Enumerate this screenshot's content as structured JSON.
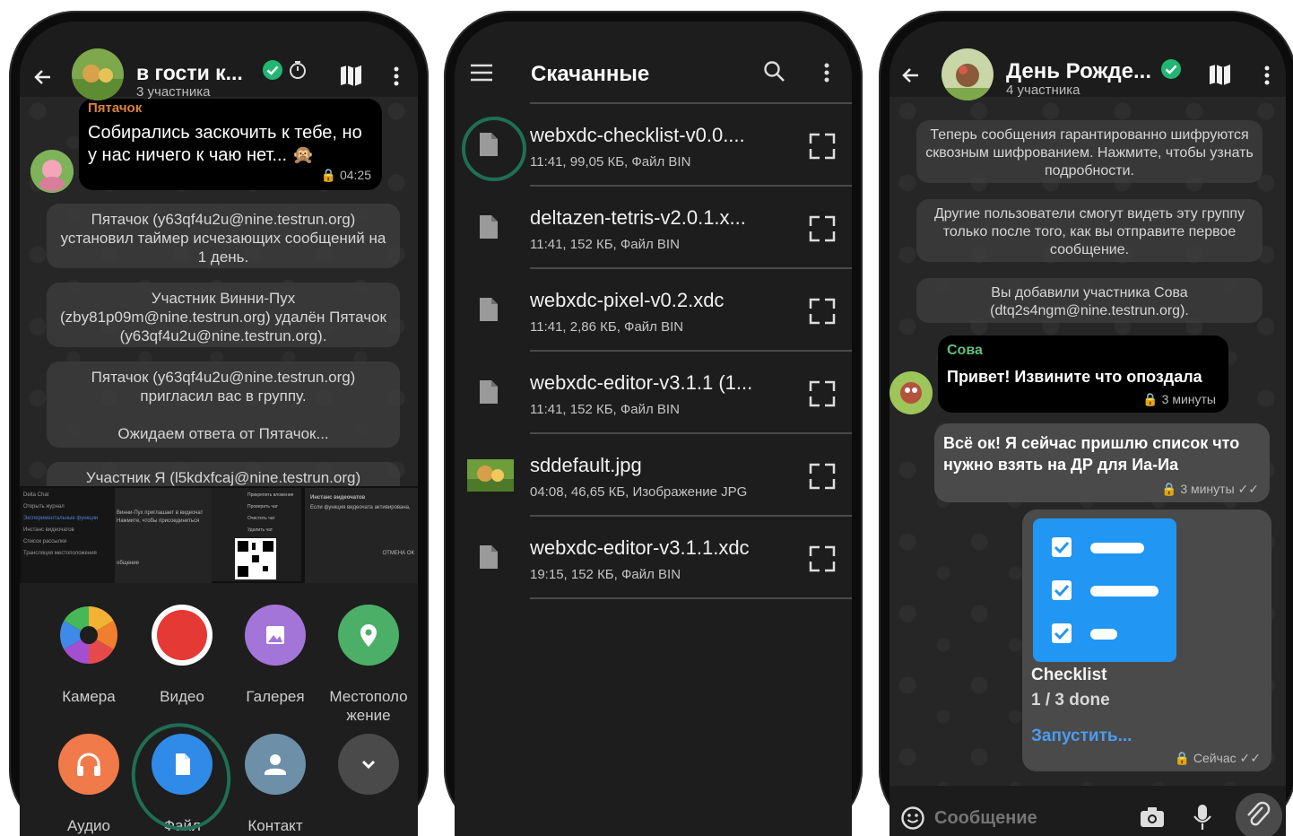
{
  "phone1": {
    "title": "в гости к...",
    "subtitle": "3 участника",
    "partial_sender": "Пятачок",
    "message": {
      "text": "Собирались заскочить к тебе, но у нас ничего к чаю нет... 🙊",
      "time": "04:25"
    },
    "system_messages": [
      "Пятачок (y63qf4u2u@nine.testrun.org) установил таймер исчезающих сообщений на 1 день.",
      "Участник Винни-Пух (zby81p09m@nine.testrun.org) удалён Пятачок (y63qf4u2u@nine.testrun.org).",
      "Пятачок (y63qf4u2u@nine.testrun.org) пригласил вас в группу.\n\nОжидаем ответа от Пятачок...",
      "Участник Я (l5kdxfcaj@nine.testrun.org)"
    ],
    "thumbnails": [
      {
        "lines": [
          "Delta Chat",
          "Открыть журнал",
          "Экспериментальные функции",
          "Инстанс видеочатов",
          "Список рассылки",
          "Трансляция местоположения"
        ]
      },
      {
        "lines": [
          "Винни-Пух приглашает в видеочат",
          "Нажмите, чтобы присоединиться",
          "общение"
        ]
      },
      {
        "lines": [
          "Прикрепить вложение",
          "Проверить чат",
          "Очистить чат",
          "Удалить чат"
        ]
      },
      {
        "lines": [
          "Инстанс видеочатов",
          "Если функция видеочата активирована,",
          "ОТМЕНА",
          "ОК"
        ]
      }
    ],
    "attachments": [
      {
        "label": "Камера",
        "color": "#2b2b2b",
        "icon": "camera-icon"
      },
      {
        "label": "Видео",
        "color": "#ffffff",
        "icon": "record-icon"
      },
      {
        "label": "Галерея",
        "color": "#a475d8",
        "icon": "gallery-icon"
      },
      {
        "label": "Местоположение",
        "color": "#4caf68",
        "icon": "location-icon"
      },
      {
        "label": "Аудио",
        "color": "#f07a4a",
        "icon": "headphones-icon"
      },
      {
        "label": "Файл",
        "color": "#2f8ae8",
        "icon": "file-icon"
      },
      {
        "label": "Контакт",
        "color": "#6d8fa8",
        "icon": "contact-icon"
      },
      {
        "label": "",
        "color": "#4a4a4a",
        "icon": "chevron-down-icon"
      }
    ]
  },
  "phone2": {
    "title": "Скачанные",
    "files": [
      {
        "name": "webxdc-checklist-v0.0....",
        "meta": "11:41, 99,05 КБ, Файл BIN",
        "thumb": false
      },
      {
        "name": "deltazen-tetris-v2.0.1.x...",
        "meta": "11:41, 152 КБ, Файл BIN",
        "thumb": false
      },
      {
        "name": "webxdc-pixel-v0.2.xdc",
        "meta": "11:41, 2,86 КБ, Файл BIN",
        "thumb": false
      },
      {
        "name": "webxdc-editor-v3.1.1 (1...",
        "meta": "11:41, 152 КБ, Файл BIN",
        "thumb": false
      },
      {
        "name": "sddefault.jpg",
        "meta": "04:08, 46,65 КБ, Изображение JPG",
        "thumb": true
      },
      {
        "name": "webxdc-editor-v3.1.1.xdc",
        "meta": "19:15, 152 КБ, Файл BIN",
        "thumb": false
      }
    ]
  },
  "phone3": {
    "title": "День Рожде...",
    "subtitle": "4 участника",
    "system_messages": [
      "Теперь сообщения гарантированно шифруются сквозным шифрованием. Нажмите, чтобы узнать подробности.",
      "Другие пользователи смогут видеть эту группу только после того, как вы отправите первое сообщение.",
      "Вы добавили участника Сова (dtq2s4ngm@nine.testrun.org)."
    ],
    "incoming": {
      "sender": "Сова",
      "text": "Привет! Извините что опоздала",
      "time": "3 минуты"
    },
    "outgoing": {
      "text": "Всё ок! Я сейчас пришлю список что нужно взять на ДР для Иа-Иа",
      "time": "3 минуты"
    },
    "app_message": {
      "name": "Checklist",
      "status": "1 / 3 done",
      "action": "Запустить...",
      "time": "Сейчас"
    },
    "composer": {
      "placeholder": "Сообщение"
    }
  },
  "colors": {
    "accent_green": "#22b573",
    "sender_green": "#5fbf7f",
    "link_blue": "#4a9cf0",
    "checklist_blue": "#2196f3"
  }
}
